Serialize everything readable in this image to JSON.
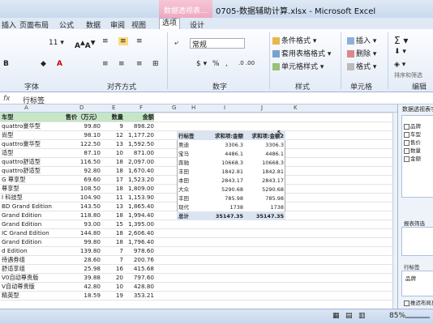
{
  "window": {
    "tool_context": "数据透视表...",
    "title": "0705-数据辅助计算.xlsx - Microsoft Excel"
  },
  "ribbon": {
    "tabs": [
      "插入",
      "页面布局",
      "公式",
      "数据",
      "审阅",
      "视图",
      "选项",
      "设计"
    ],
    "active_tab": "选项",
    "font_size": "11",
    "number_format": "常规",
    "styles": [
      "条件格式",
      "套用表格格式",
      "单元格样式"
    ],
    "cells": [
      "插入",
      "删除",
      "格式"
    ],
    "group_labels": [
      "字体",
      "对齐方式",
      "数字",
      "样式",
      "单元格",
      "编辑"
    ],
    "filter_label": "排序和筛选"
  },
  "formula_bar": {
    "fx": "fx",
    "content": "行标签"
  },
  "columns": [
    "A",
    "B",
    "C",
    "D",
    "E",
    "F",
    "G",
    "H",
    "I",
    "J",
    "K"
  ],
  "sheet": {
    "header": [
      "车型",
      "售价（万元）",
      "数量",
      "金额"
    ],
    "rows": [
      [
        "quattro豪华型",
        "99.80",
        "9",
        "898.20"
      ],
      [
        "尚型",
        "98.10",
        "12",
        "1,177.20"
      ],
      [
        "quattro豪华型",
        "122.50",
        "13",
        "1,592.50"
      ],
      [
        "适型",
        "87.10",
        "10",
        "871.00"
      ],
      [
        "quattro舒适型",
        "116.50",
        "18",
        "2,097.00"
      ],
      [
        "quattro舒适型",
        "92.80",
        "18",
        "1,670.40"
      ],
      [
        "G 尊享型",
        "69.60",
        "17",
        "1,523.20"
      ],
      [
        "尊享型",
        "108.50",
        "18",
        "1,809.00"
      ],
      [
        "l 科技型",
        "104.90",
        "11",
        "1,153.90"
      ],
      [
        "BD Grand Edition",
        "143.50",
        "13",
        "1,865.40"
      ],
      [
        "Grand Edition",
        "118.80",
        "18",
        "1,994.40"
      ],
      [
        "Grand Edition",
        "93.00",
        "15",
        "1,395.00"
      ],
      [
        "IC Grand Edition",
        "144.80",
        "18",
        "2,606.40"
      ],
      [
        "Grand Edition",
        "99.80",
        "18",
        "1,796.40"
      ],
      [
        "d Edition",
        "139.80",
        "7",
        "978.60"
      ],
      [
        "待遇券组",
        "28.60",
        "7",
        "200.76"
      ],
      [
        "舒适享组",
        "25.98",
        "16",
        "415.68"
      ],
      [
        "V0自动尊贵版",
        "39.88",
        "20",
        "797.60"
      ],
      [
        "V自动尊贵版",
        "42.80",
        "10",
        "428.80"
      ],
      [
        "精英型",
        "18.59",
        "19",
        "353.21"
      ]
    ]
  },
  "pivot": {
    "header": [
      "行标签",
      "求和项:金额",
      "求和项:金额2"
    ],
    "rows": [
      [
        "奥迪",
        "3306.3",
        "3306.3"
      ],
      [
        "宝马",
        "4486.1",
        "4486.1"
      ],
      [
        "奔驰",
        "10668.3",
        "10668.3"
      ],
      [
        "丰田",
        "1842.81",
        "1842.81"
      ],
      [
        "本田",
        "2843.17",
        "2843.17"
      ],
      [
        "大众",
        "5290.68",
        "5290.68"
      ],
      [
        "丰田",
        "785.98",
        "785.98"
      ],
      [
        "现代",
        "1738",
        "1738"
      ]
    ],
    "total": [
      "总计",
      "35147.35",
      "35147.35"
    ]
  },
  "pane": {
    "title": "数据透视表字段列表",
    "fields": [
      "品牌",
      "车型",
      "售价",
      "数量",
      "金额"
    ],
    "filter_label": "报表筛选",
    "row_label": "行标签",
    "row_field": "品牌",
    "defer_label": "推迟布局更新"
  },
  "status": {
    "zoom": "85%"
  }
}
